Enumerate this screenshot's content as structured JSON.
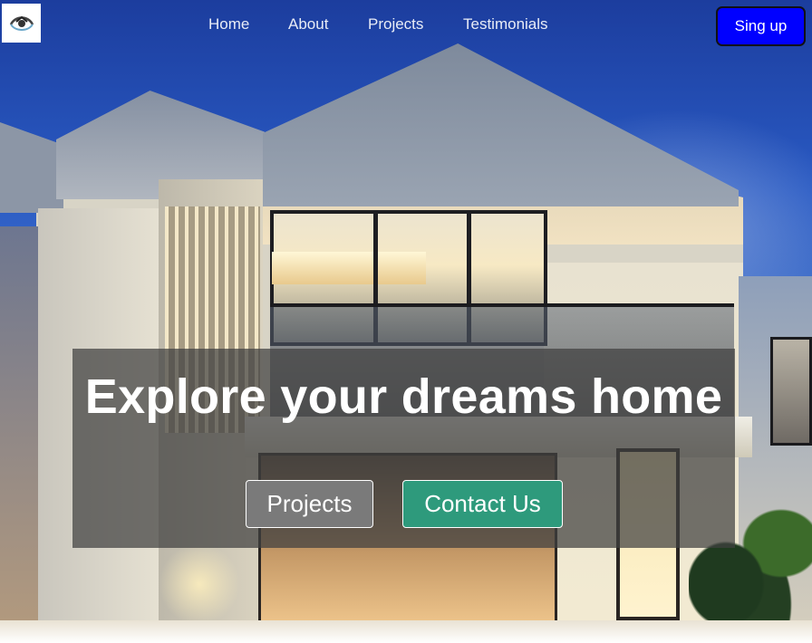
{
  "brand": {
    "logo_icon": "house-eye-logo-icon"
  },
  "nav": {
    "links": [
      "Home",
      "About",
      "Projects",
      "Testimonials"
    ],
    "signup_label": "Sing up",
    "signup_color": "#0000ff"
  },
  "hero": {
    "headline": "Explore your dreams home",
    "buttons": {
      "projects_label": "Projects",
      "contact_label": "Contact Us"
    },
    "colors": {
      "projects": "#7a7a7a",
      "contact": "#2e9a7c"
    }
  }
}
